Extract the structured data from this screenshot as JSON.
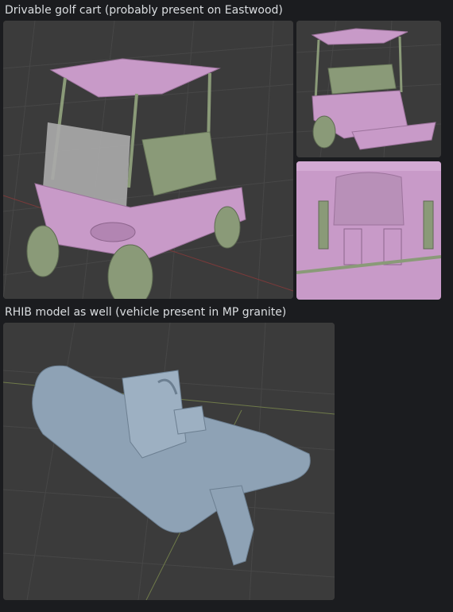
{
  "messages": [
    {
      "text": "Drivable golf cart (probably present on Eastwood)",
      "attachments": [
        {
          "subject": "golf cart 3/4 front view render"
        },
        {
          "subject": "golf cart rear view render"
        },
        {
          "subject": "golf cart suspension close-up render"
        }
      ]
    },
    {
      "text": "RHIB model as well (vehicle present in MP granite)",
      "attachments": [
        {
          "subject": "RHIB boat render"
        }
      ]
    }
  ],
  "colors": {
    "background": "#1b1c1f",
    "viewport_bg": "#3b3b3b",
    "grid_line": "#4a4a4a",
    "cart_body": "#c89ac8",
    "cart_green": "#8a9a78",
    "windshield": "#a9a9a9",
    "boat": "#8ea2b5"
  }
}
